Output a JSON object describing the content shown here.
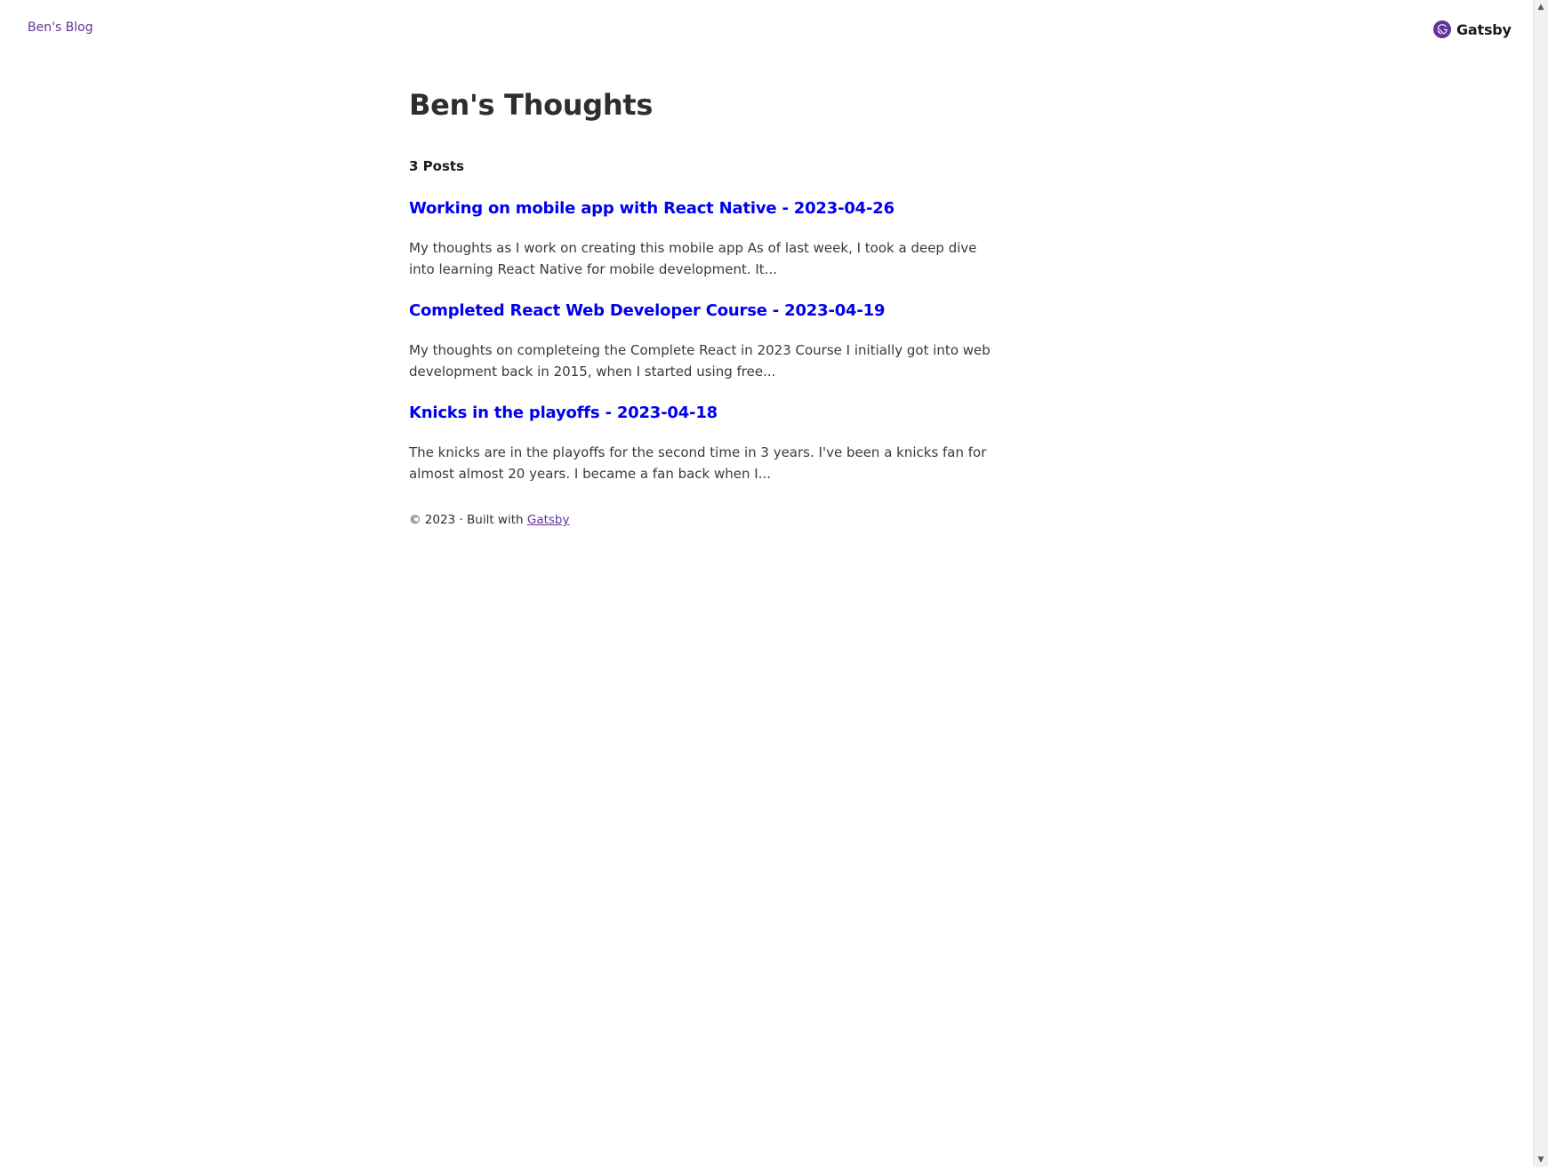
{
  "header": {
    "site_title": "Ben's Blog",
    "brand_name": "Gatsby",
    "brand_color": "#663399"
  },
  "main": {
    "heading": "Ben's Thoughts",
    "post_count": "3 Posts",
    "posts": [
      {
        "title": "Working on mobile app with React Native - 2023-04-26",
        "excerpt": "My thoughts as I work on creating this mobile app As of last week, I took a deep dive into learning React Native for mobile development. It..."
      },
      {
        "title": "Completed React Web Developer Course - 2023-04-19",
        "excerpt": "My thoughts on completeing the Complete React in 2023 Course I initially got into web development back in 2015, when I started using free..."
      },
      {
        "title": "Knicks in the playoffs - 2023-04-18",
        "excerpt": "The knicks are in the playoffs for the second time in 3 years. I've been a knicks fan for almost almost 20 years. I became a fan back when I..."
      }
    ],
    "link_color": "#0000ee"
  },
  "footer": {
    "prefix": "© 2023 · Built with ",
    "link_label": "Gatsby"
  },
  "scrollbar": {
    "up_icon": "▲",
    "down_icon": "▼"
  }
}
